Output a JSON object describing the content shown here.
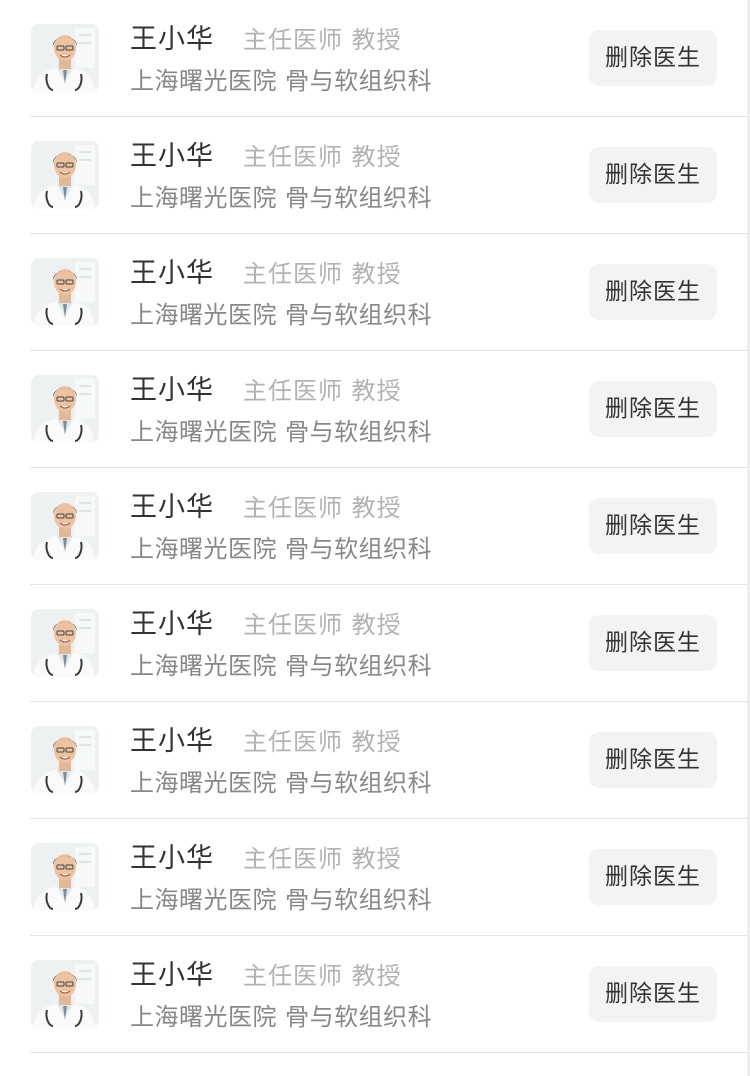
{
  "doctors": [
    {
      "name": "王小华",
      "title": "主任医师 教授",
      "hospital": "上海曙光医院 骨与软组织科",
      "action_label": "删除医生",
      "avatar_icon": "doctor-avatar-icon"
    },
    {
      "name": "王小华",
      "title": "主任医师 教授",
      "hospital": "上海曙光医院 骨与软组织科",
      "action_label": "删除医生",
      "avatar_icon": "doctor-avatar-icon"
    },
    {
      "name": "王小华",
      "title": "主任医师 教授",
      "hospital": "上海曙光医院 骨与软组织科",
      "action_label": "删除医生",
      "avatar_icon": "doctor-avatar-icon"
    },
    {
      "name": "王小华",
      "title": "主任医师 教授",
      "hospital": "上海曙光医院 骨与软组织科",
      "action_label": "删除医生",
      "avatar_icon": "doctor-avatar-icon"
    },
    {
      "name": "王小华",
      "title": "主任医师 教授",
      "hospital": "上海曙光医院 骨与软组织科",
      "action_label": "删除医生",
      "avatar_icon": "doctor-avatar-icon"
    },
    {
      "name": "王小华",
      "title": "主任医师 教授",
      "hospital": "上海曙光医院 骨与软组织科",
      "action_label": "删除医生",
      "avatar_icon": "doctor-avatar-icon"
    },
    {
      "name": "王小华",
      "title": "主任医师 教授",
      "hospital": "上海曙光医院 骨与软组织科",
      "action_label": "删除医生",
      "avatar_icon": "doctor-avatar-icon"
    },
    {
      "name": "王小华",
      "title": "主任医师 教授",
      "hospital": "上海曙光医院 骨与软组织科",
      "action_label": "删除医生",
      "avatar_icon": "doctor-avatar-icon"
    },
    {
      "name": "王小华",
      "title": "主任医师 教授",
      "hospital": "上海曙光医院 骨与软组织科",
      "action_label": "删除医生",
      "avatar_icon": "doctor-avatar-icon"
    }
  ],
  "colors": {
    "name_text": "#333333",
    "title_text": "#b2b2b2",
    "hospital_text": "#888888",
    "button_bg": "#f3f3f3",
    "divider": "#e3e3e3"
  }
}
